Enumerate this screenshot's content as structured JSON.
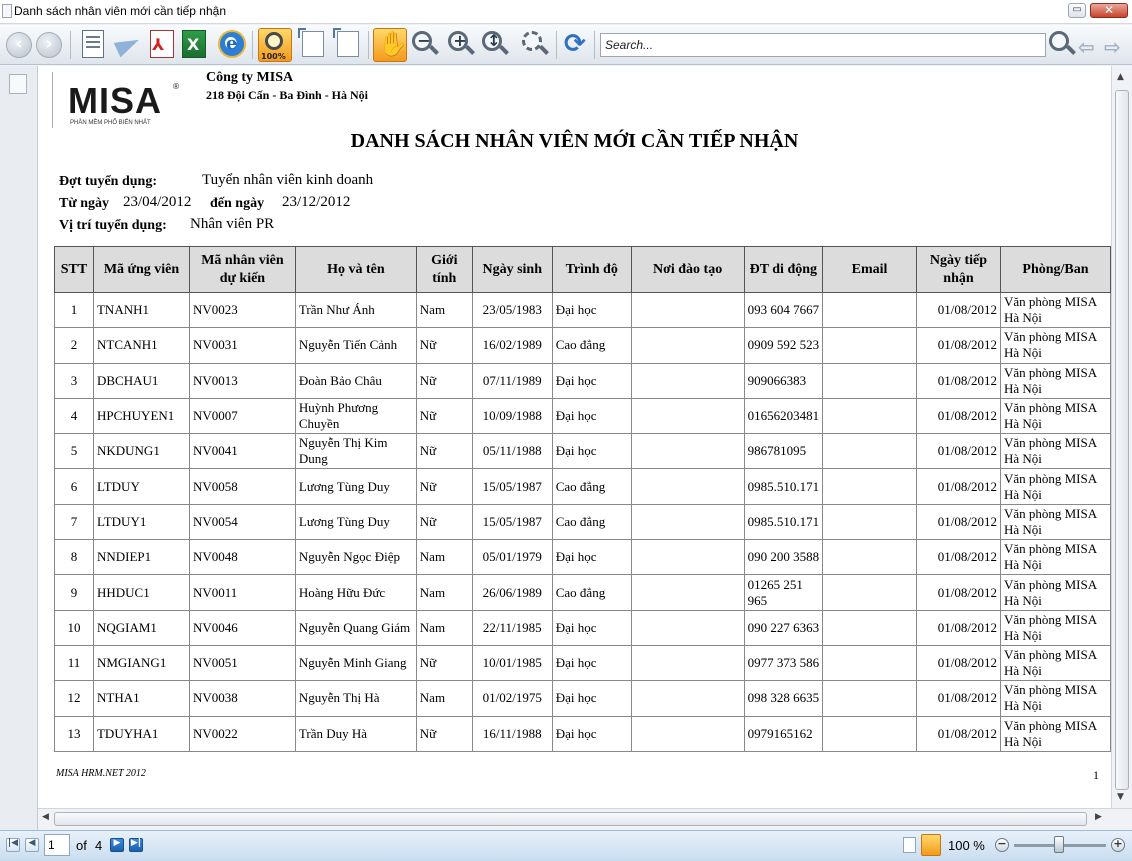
{
  "window": {
    "title": "Danh sách nhân viên mới cần tiếp nhận"
  },
  "toolbar": {
    "zoom100_label": "100%",
    "search_placeholder": "Search..."
  },
  "report": {
    "company": "Công ty MISA",
    "address": "218 Đội Cấn -  Ba Đình - Hà Nội",
    "logo_word": "MISA",
    "logo_reg": "®",
    "logo_tagline": "PHẦN MỀM PHỔ BIẾN NHẤT",
    "title": "DANH SÁCH NHÂN VIÊN MỚI CẦN TIẾP NHẬN",
    "round_label": "Đợt tuyển dụng:",
    "round_value": "Tuyển nhân viên kinh doanh",
    "from_label": "Từ ngày",
    "from_value": "23/04/2012",
    "to_label": "đến ngày",
    "to_value": "23/12/2012",
    "position_label": "Vị trí tuyển dụng:",
    "position_value": "Nhân viên PR",
    "footer_note": "MISA HRM.NET 2012",
    "page_number": "1"
  },
  "table": {
    "headers": {
      "stt": "STT",
      "candidate_code": "Mã ứng viên",
      "employee_code": "Mã nhân viên dự kiến",
      "full_name": "Họ và tên",
      "gender": "Giới tính",
      "birth_date": "Ngày sinh",
      "education": "Trình độ",
      "school": "Nơi đào tạo",
      "mobile": "ĐT di động",
      "email": "Email",
      "receive_date": "Ngày tiếp nhận",
      "department": "Phòng/Ban"
    },
    "rows": [
      {
        "stt": "1",
        "candidate_code": "TNANH1",
        "employee_code": "NV0023",
        "full_name": "Trần Như Ánh",
        "gender": "Nam",
        "birth_date": "23/05/1983",
        "education": "Đại học",
        "school": "",
        "mobile": "093 604 7667",
        "email": "",
        "receive_date": "01/08/2012",
        "department": "Văn phòng MISA Hà Nội"
      },
      {
        "stt": "2",
        "candidate_code": "NTCANH1",
        "employee_code": "NV0031",
        "full_name": "Nguyễn Tiến  Cảnh",
        "gender": "Nữ",
        "birth_date": "16/02/1989",
        "education": "Cao đẳng",
        "school": "",
        "mobile": "0909 592 523",
        "email": "",
        "receive_date": "01/08/2012",
        "department": "Văn phòng MISA Hà Nội"
      },
      {
        "stt": "3",
        "candidate_code": "DBCHAU1",
        "employee_code": "NV0013",
        "full_name": "Đoàn Bảo Châu",
        "gender": "Nữ",
        "birth_date": "07/11/1989",
        "education": "Đại học",
        "school": "",
        "mobile": "909066383",
        "email": "",
        "receive_date": "01/08/2012",
        "department": "Văn phòng MISA Hà Nội"
      },
      {
        "stt": "4",
        "candidate_code": "HPCHUYEN1",
        "employee_code": "NV0007",
        "full_name": "Huỳnh Phương Chuyền",
        "gender": "Nữ",
        "birth_date": "10/09/1988",
        "education": "Đại học",
        "school": "",
        "mobile": "01656203481",
        "email": "",
        "receive_date": "01/08/2012",
        "department": "Văn phòng MISA Hà Nội"
      },
      {
        "stt": "5",
        "candidate_code": "NKDUNG1",
        "employee_code": "NV0041",
        "full_name": "Nguyễn Thị Kim Dung",
        "gender": "Nữ",
        "birth_date": "05/11/1988",
        "education": "Đại học",
        "school": "",
        "mobile": "986781095",
        "email": "",
        "receive_date": "01/08/2012",
        "department": "Văn phòng MISA Hà Nội"
      },
      {
        "stt": "6",
        "candidate_code": "LTDUY",
        "employee_code": "NV0058",
        "full_name": "Lương Tùng Duy",
        "gender": "Nữ",
        "birth_date": "15/05/1987",
        "education": "Cao đẳng",
        "school": "",
        "mobile": "0985.510.171",
        "email": "",
        "receive_date": "01/08/2012",
        "department": "Văn phòng MISA Hà Nội"
      },
      {
        "stt": "7",
        "candidate_code": "LTDUY1",
        "employee_code": "NV0054",
        "full_name": "Lương Tùng Duy",
        "gender": "Nữ",
        "birth_date": "15/05/1987",
        "education": "Cao đẳng",
        "school": "",
        "mobile": "0985.510.171",
        "email": "",
        "receive_date": "01/08/2012",
        "department": "Văn phòng MISA Hà Nội"
      },
      {
        "stt": "8",
        "candidate_code": "NNDIEP1",
        "employee_code": "NV0048",
        "full_name": "Nguyễn Ngọc Điệp",
        "gender": "Nam",
        "birth_date": "05/01/1979",
        "education": "Đại học",
        "school": "",
        "mobile": "090 200 3588",
        "email": "",
        "receive_date": "01/08/2012",
        "department": "Văn phòng MISA Hà Nội"
      },
      {
        "stt": "9",
        "candidate_code": "HHDUC1",
        "employee_code": "NV0011",
        "full_name": "Hoàng Hữu Đức",
        "gender": "Nam",
        "birth_date": "26/06/1989",
        "education": "Cao đẳng",
        "school": "",
        "mobile": "01265 251 965",
        "email": "",
        "receive_date": "01/08/2012",
        "department": "Văn phòng MISA Hà Nội"
      },
      {
        "stt": "10",
        "candidate_code": "NQGIAM1",
        "employee_code": "NV0046",
        "full_name": "Nguyễn Quang Giám",
        "gender": "Nam",
        "birth_date": "22/11/1985",
        "education": "Đại học",
        "school": "",
        "mobile": "090 227 6363",
        "email": "",
        "receive_date": "01/08/2012",
        "department": "Văn phòng MISA Hà Nội"
      },
      {
        "stt": "11",
        "candidate_code": "NMGIANG1",
        "employee_code": "NV0051",
        "full_name": "Nguyễn Minh Giang",
        "gender": "Nữ",
        "birth_date": "10/01/1985",
        "education": "Đại học",
        "school": "",
        "mobile": "0977 373 586",
        "email": "",
        "receive_date": "01/08/2012",
        "department": "Văn phòng MISA Hà Nội"
      },
      {
        "stt": "12",
        "candidate_code": "NTHA1",
        "employee_code": "NV0038",
        "full_name": "Nguyễn Thị Hà",
        "gender": "Nam",
        "birth_date": "01/02/1975",
        "education": "Đại học",
        "school": "",
        "mobile": "098 328 6635",
        "email": "",
        "receive_date": "01/08/2012",
        "department": "Văn phòng MISA Hà Nội"
      },
      {
        "stt": "13",
        "candidate_code": "TDUYHA1",
        "employee_code": "NV0022",
        "full_name": "Trần Duy Hà",
        "gender": "Nữ",
        "birth_date": "16/11/1988",
        "education": "Đại học",
        "school": "",
        "mobile": "0979165162",
        "email": "",
        "receive_date": "01/08/2012",
        "department": "Văn phòng MISA Hà Nội"
      }
    ]
  },
  "statusbar": {
    "current_page": "1",
    "of_label": "of",
    "total_pages": "4",
    "zoom_label": "100 %"
  },
  "icons": {
    "back": "back-arrow-icon",
    "forward": "forward-arrow-icon",
    "hand": "hand-pan-icon",
    "refresh": "refresh-icon"
  }
}
